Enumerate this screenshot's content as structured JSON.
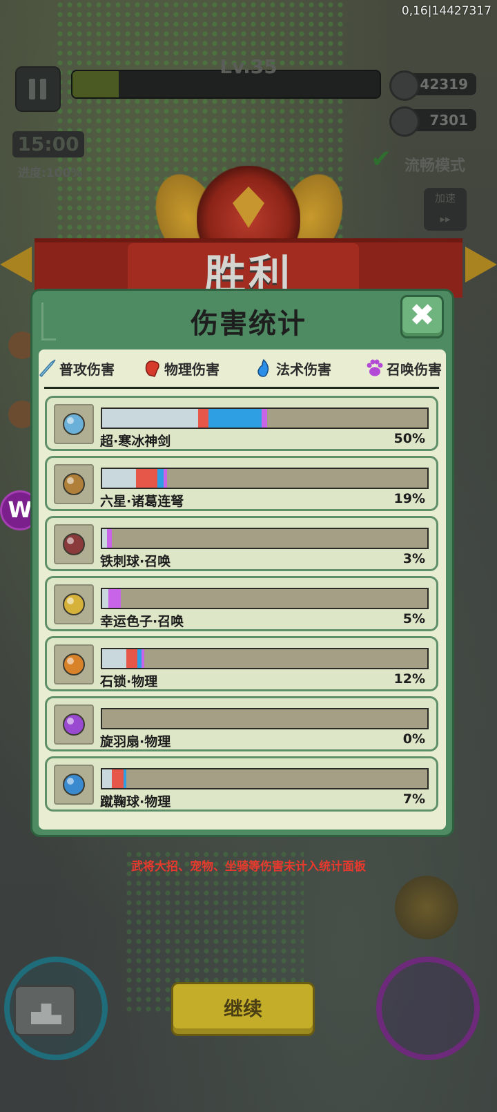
{
  "top_id": "0,16|14427317",
  "hud": {
    "level": "Lv.35",
    "level_progress": 0.15,
    "coins": "42319",
    "gems": "7301",
    "timer": "15:00",
    "progress": "进度:100%",
    "mode": "流畅模式",
    "speed_label": "加速",
    "speed_arrows": "▸▸"
  },
  "victory": {
    "title": "胜利"
  },
  "panel": {
    "title": "伤害统计",
    "close_glyph": "✖",
    "tabs": [
      {
        "label": "普攻伤害",
        "icon": "sword-icon",
        "color": "#8ac8e8"
      },
      {
        "label": "物理伤害",
        "icon": "fist-icon",
        "color": "#d63a2a"
      },
      {
        "label": "法术伤害",
        "icon": "flame-icon",
        "color": "#2b8fe8"
      },
      {
        "label": "召唤伤害",
        "icon": "paw-icon",
        "color": "#b24ad6"
      }
    ],
    "rows": [
      {
        "name": "超·寒冰神剑",
        "percent": "50%",
        "icon": "ice-sword-icon",
        "segments": [
          {
            "type": "normal",
            "from": 0,
            "to": 0.295
          },
          {
            "type": "physical",
            "from": 0.295,
            "to": 0.328
          },
          {
            "type": "magic",
            "from": 0.328,
            "to": 0.49
          },
          {
            "type": "summon",
            "from": 0.49,
            "to": 0.508
          }
        ]
      },
      {
        "name": "六星·诸葛连弩",
        "percent": "19%",
        "icon": "crossbow-icon",
        "segments": [
          {
            "type": "normal",
            "from": 0,
            "to": 0.103
          },
          {
            "type": "physical",
            "from": 0.103,
            "to": 0.17
          },
          {
            "type": "magic",
            "from": 0.17,
            "to": 0.188
          },
          {
            "type": "summon",
            "from": 0.188,
            "to": 0.2
          }
        ]
      },
      {
        "name": "铁刺球·召唤",
        "percent": "3%",
        "icon": "spike-ball-icon",
        "segments": [
          {
            "type": "normal",
            "from": 0,
            "to": 0.015
          },
          {
            "type": "summon",
            "from": 0.015,
            "to": 0.03
          }
        ]
      },
      {
        "name": "幸运色子·召唤",
        "percent": "5%",
        "icon": "dice-icon",
        "segments": [
          {
            "type": "normal",
            "from": 0,
            "to": 0.02
          },
          {
            "type": "summon",
            "from": 0.02,
            "to": 0.058
          }
        ]
      },
      {
        "name": "石锁·物理",
        "percent": "12%",
        "icon": "stone-lock-icon",
        "segments": [
          {
            "type": "normal",
            "from": 0,
            "to": 0.075
          },
          {
            "type": "physical",
            "from": 0.075,
            "to": 0.108
          },
          {
            "type": "magic",
            "from": 0.108,
            "to": 0.122
          },
          {
            "type": "summon",
            "from": 0.122,
            "to": 0.13
          }
        ]
      },
      {
        "name": "旋羽扇·物理",
        "percent": "0%",
        "icon": "feather-fan-icon",
        "segments": []
      },
      {
        "name": "蹴鞠球·物理",
        "percent": "7%",
        "icon": "kickball-icon",
        "segments": [
          {
            "type": "normal",
            "from": 0,
            "to": 0.03
          },
          {
            "type": "physical",
            "from": 0.03,
            "to": 0.065
          },
          {
            "type": "magic",
            "from": 0.065,
            "to": 0.075
          }
        ]
      }
    ]
  },
  "colors": {
    "normal": "#c9d8dc",
    "physical": "#e6574a",
    "magic": "#2d9fe2",
    "summon": "#c864e8"
  },
  "note": "武将大招、宠物、坐骑等伤害未计入统计面板",
  "continue_label": "继续"
}
